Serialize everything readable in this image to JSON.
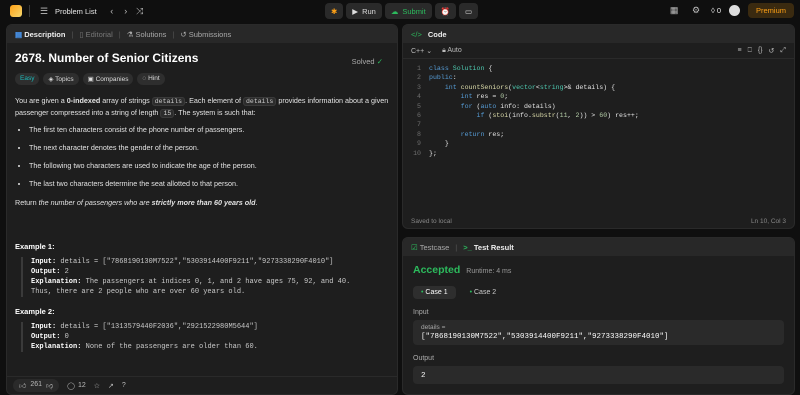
{
  "topbar": {
    "problem_list": "Problem List",
    "run": "Run",
    "submit": "Submit",
    "streak": "0",
    "premium": "Premium"
  },
  "left_panel": {
    "tabs": [
      "Description",
      "Editorial",
      "Solutions",
      "Submissions"
    ],
    "title": "2678. Number of Senior Citizens",
    "solved": "Solved",
    "tags": [
      "Easy",
      "Topics",
      "Companies",
      "Hint"
    ],
    "para1_a": "You are given a ",
    "para1_b": "0-indexed",
    "para1_c": " array of strings ",
    "para1_code1": "details",
    "para1_d": ". Each element of ",
    "para1_code2": "details",
    "para1_e": " provides information about a given passenger compressed into a string of length ",
    "para1_code3": "15",
    "para1_f": ". The system is such that:",
    "bullets": [
      "The first ten characters consist of the phone number of passengers.",
      "The next character denotes the gender of the person.",
      "The following two characters are used to indicate the age of the person.",
      "The last two characters determine the seat allotted to that person."
    ],
    "return_a": "Return ",
    "return_b": "the number of passengers who are ",
    "return_c": "strictly more than 60 years old",
    "return_d": ".",
    "example1_title": "Example 1:",
    "example1_input_label": "Input:",
    "example1_input": " details = [\"7868190130M7522\",\"5303914400F9211\",\"9273338290F4010\"]",
    "example1_output_label": "Output:",
    "example1_output": " 2",
    "example1_expl_label": "Explanation:",
    "example1_expl": " The passengers at indices 0, 1, and 2 have ages 75, 92, and 40.",
    "example1_expl2": "Thus, there are 2 people who are over 60 years old.",
    "example2_title": "Example 2:",
    "example2_input_label": "Input:",
    "example2_input": " details = [\"1313579440F2036\",\"2921522980M5644\"]",
    "example2_output_label": "Output:",
    "example2_output": " 0",
    "example2_expl_label": "Explanation:",
    "example2_expl": " None of the passengers are older than 60.",
    "likes": "261",
    "comments": "12"
  },
  "code_panel": {
    "title": "Code",
    "language": "C++",
    "auto": "Auto",
    "lines": [
      {
        "n": "1",
        "html": "<span class='kw'>class</span> <span class='ty'>Solution</span> {"
      },
      {
        "n": "2",
        "html": "<span class='kw'>public</span>:"
      },
      {
        "n": "3",
        "html": "    <span class='kw'>int</span> <span class='fn'>countSeniors</span>(<span class='ty'>vector</span>&lt;<span class='ty'>string</span>&gt;&amp; details) {"
      },
      {
        "n": "4",
        "html": "        <span class='kw'>int</span> res = <span class='num'>0</span>;"
      },
      {
        "n": "5",
        "html": "        <span class='kw'>for</span> (<span class='kw'>auto</span> info: details)"
      },
      {
        "n": "6",
        "html": "            <span class='kw'>if</span> (<span class='fn'>stoi</span>(info.<span class='fn'>substr</span>(<span class='num'>11</span>, <span class='num'>2</span>)) &gt; <span class='num'>60</span>) res++;"
      },
      {
        "n": "7",
        "html": ""
      },
      {
        "n": "8",
        "html": "        <span class='kw'>return</span> res;"
      },
      {
        "n": "9",
        "html": "    }"
      },
      {
        "n": "10",
        "html": "};"
      }
    ],
    "saved": "Saved to local",
    "position": "Ln 10, Col 3"
  },
  "result_panel": {
    "tab_testcase": "Testcase",
    "tab_result": "Test Result",
    "status": "Accepted",
    "runtime": "Runtime: 4 ms",
    "case1": "Case 1",
    "case2": "Case 2",
    "input_label": "Input",
    "input_sub": "details =",
    "input_value": "[\"7868190130M7522\",\"5303914400F9211\",\"9273338290F4010\"]",
    "output_label": "Output",
    "output_value": "2"
  }
}
